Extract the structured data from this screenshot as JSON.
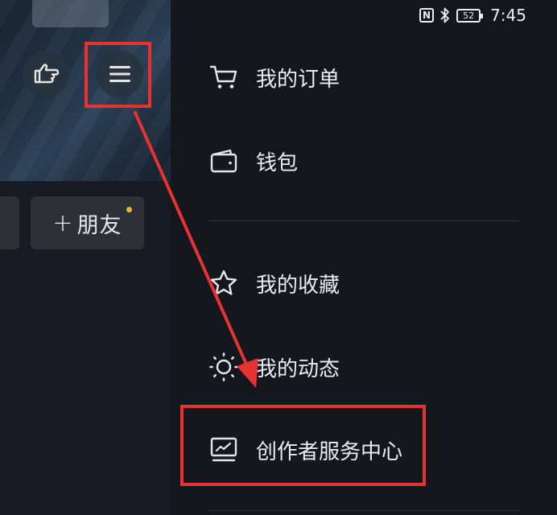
{
  "status_bar": {
    "battery": "52",
    "time": "7:45"
  },
  "profile": {
    "add_friend_label": "朋友",
    "add_friend_plus": "+"
  },
  "drawer": {
    "items": [
      {
        "label": "我的订单",
        "icon": "cart-icon"
      },
      {
        "label": "钱包",
        "icon": "wallet-icon"
      },
      {
        "label": "我的收藏",
        "icon": "star-icon"
      },
      {
        "label": "我的动态",
        "icon": "sun-icon"
      },
      {
        "label": "创作者服务中心",
        "icon": "chart-icon"
      }
    ]
  },
  "colors": {
    "highlight": "#e8322f",
    "drawer_bg": "#15171f",
    "dot": "#e8b725"
  }
}
